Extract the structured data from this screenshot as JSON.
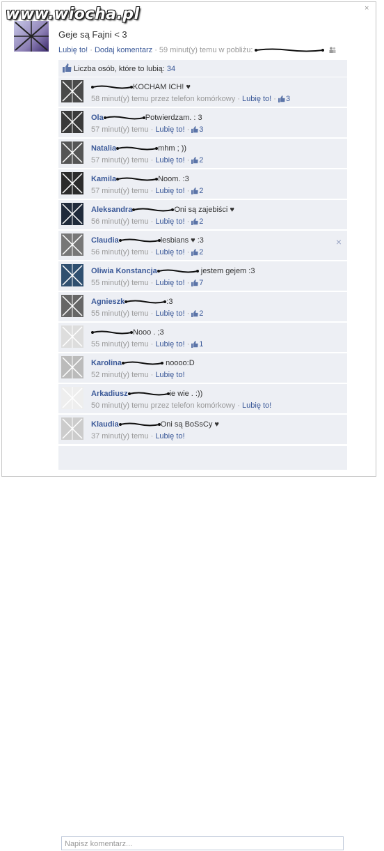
{
  "watermark": "www.wiocha.pl",
  "post": {
    "text": "Geje są Fajni < 3",
    "like": "Lubię to!",
    "separator": " · ",
    "comment": "Dodaj komentarz",
    "time": "59 minut(y) temu w pobliżu:"
  },
  "likes": {
    "label": "Liczba osób, które to lubią:",
    "count": "34"
  },
  "comments": [
    {
      "author": "",
      "text": "KOCHAM ICH! ♥",
      "time": "58 minut(y) temu przez telefon komórkowy",
      "like": "Lubię to!",
      "count": "3",
      "avatar": "#4a4a4a"
    },
    {
      "author": "Ola",
      "text": "Potwierdzam. : 3",
      "time": "57 minut(y) temu",
      "like": "Lubię to!",
      "count": "3",
      "avatar": "#3a3a3a"
    },
    {
      "author": "Natalia",
      "text": "mhm ; ))",
      "time": "57 minut(y) temu",
      "like": "Lubię to!",
      "count": "2",
      "avatar": "#555"
    },
    {
      "author": "Kamila",
      "text": "Noom. :3",
      "time": "57 minut(y) temu",
      "like": "Lubię to!",
      "count": "2",
      "avatar": "#2b2b2b"
    },
    {
      "author": "Aleksandra",
      "text": "Oni są zajebiści ♥",
      "time": "56 minut(y) temu",
      "like": "Lubię to!",
      "count": "2",
      "avatar": "#1f2a3a"
    },
    {
      "author": "Claudia",
      "text": "lesbians ♥ :3",
      "time": "56 minut(y) temu",
      "like": "Lubię to!",
      "count": "2",
      "avatar": "#777",
      "close": "×"
    },
    {
      "author": "Oliwia Konstancja",
      "text": " jestem gejem :3",
      "time": "55 minut(y) temu",
      "like": "Lubię to!",
      "count": "7",
      "avatar": "#2f4f6f"
    },
    {
      "author": "Agnieszk",
      "text": ":3",
      "time": "55 minut(y) temu",
      "like": "Lubię to!",
      "count": "2",
      "avatar": "#666"
    },
    {
      "author": "",
      "text": "Nooo . ;3",
      "time": "55 minut(y) temu",
      "like": "Lubię to!",
      "count": "1",
      "avatar": "#ddd"
    },
    {
      "author": "Karolina",
      "text": " noooo:D",
      "time": "52 minut(y) temu",
      "like": "Lubię to!",
      "count": "",
      "avatar": "#bbb"
    },
    {
      "author": "Arkadiusz",
      "text": "ie wie . :))",
      "time": "50 minut(y) temu przez telefon komórkowy",
      "like": "Lubię to!",
      "count": "",
      "avatar": "#eee"
    },
    {
      "author": "Klaudia",
      "text": "Oni są BoSsCy ♥",
      "time": "37 minut(y) temu",
      "like": "Lubię to!",
      "count": "",
      "avatar": "#ccc"
    }
  ],
  "input": {
    "placeholder": "Napisz komentarz..."
  },
  "close_glyph": "×"
}
